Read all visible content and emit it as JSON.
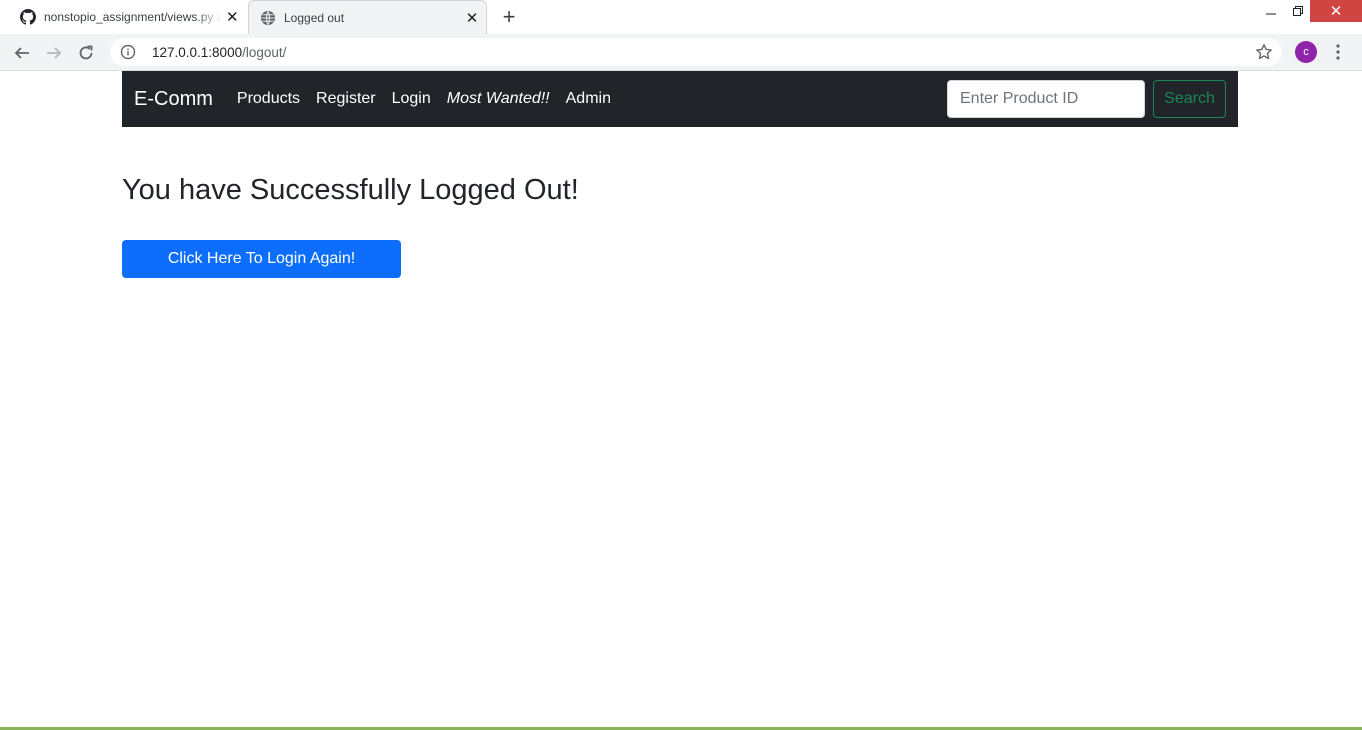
{
  "browser": {
    "tabs": [
      {
        "title": "nonstopio_assignment/views.py at",
        "favicon": "github-icon",
        "active": false
      },
      {
        "title": "Logged out",
        "favicon": "globe-icon",
        "active": true
      }
    ],
    "url_host": "127.0.0.1:8000",
    "url_path": "/logout/",
    "profile_initial": "c",
    "profile_color": "#8e24aa"
  },
  "navbar": {
    "brand": "E-Comm",
    "links": [
      "Products",
      "Register",
      "Login",
      "Most Wanted!!",
      "Admin"
    ],
    "search_placeholder": "Enter Product ID",
    "search_button": "Search",
    "background": "#212529"
  },
  "main": {
    "heading": "You have Successfully Logged Out!",
    "login_button": "Click Here To Login Again!",
    "button_color": "#0d6efd"
  }
}
